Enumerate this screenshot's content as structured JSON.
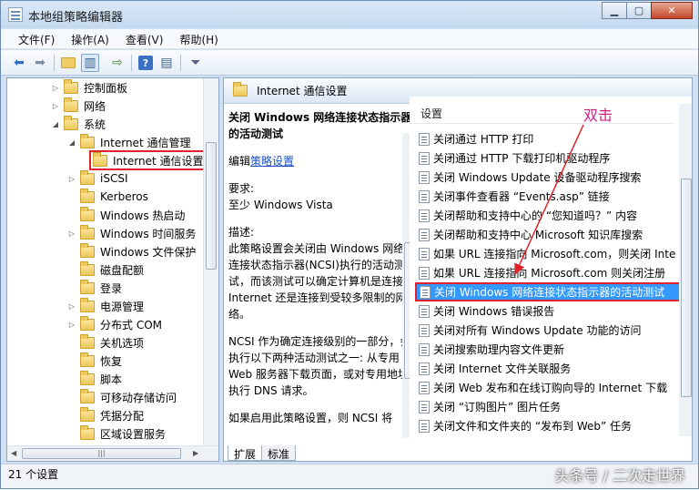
{
  "window": {
    "title": "本地组策略编辑器"
  },
  "menu": {
    "items": [
      "文件(F)",
      "操作(A)",
      "查看(V)",
      "帮助(H)"
    ]
  },
  "tree": {
    "items": [
      {
        "label": "控制面板",
        "arrow": "▷"
      },
      {
        "label": "网络",
        "arrow": "▷"
      },
      {
        "label": "系统",
        "arrow": "◢"
      },
      {
        "label": "Internet 通信管理",
        "arrow": "◢"
      },
      {
        "label": "Internet 通信设置",
        "arrow": ""
      },
      {
        "label": "iSCSI",
        "arrow": "▷"
      },
      {
        "label": "Kerberos",
        "arrow": ""
      },
      {
        "label": "Windows 热启动",
        "arrow": ""
      },
      {
        "label": "Windows 时间服务",
        "arrow": "▷"
      },
      {
        "label": "Windows 文件保护",
        "arrow": ""
      },
      {
        "label": "磁盘配额",
        "arrow": ""
      },
      {
        "label": "登录",
        "arrow": ""
      },
      {
        "label": "电源管理",
        "arrow": "▷"
      },
      {
        "label": "分布式 COM",
        "arrow": "▷"
      },
      {
        "label": "关机选项",
        "arrow": ""
      },
      {
        "label": "恢复",
        "arrow": ""
      },
      {
        "label": "脚本",
        "arrow": ""
      },
      {
        "label": "可移动存储访问",
        "arrow": ""
      },
      {
        "label": "凭据分配",
        "arrow": ""
      },
      {
        "label": "区域设置服务",
        "arrow": ""
      }
    ]
  },
  "right": {
    "header": "Internet 通信设置",
    "description": {
      "title": "关闭 Windows 网络连接状态指示器的活动测试",
      "edit_prefix": "编辑",
      "edit_link": "策略设置",
      "req_label": "要求:",
      "req_value": "至少 Windows Vista",
      "desc_label": "描述:",
      "desc_text": "此策略设置会关闭由 Windows 网络连接状态指示器(NCSI)执行的活动测试，而该测试可以确定计算机是连接到 Internet 还是连接到受较多限制的网络。",
      "desc_text2": "NCSI 作为确定连接级别的一部分，会执行以下两种活动测试之一: 从专用 Web 服务器下载页面，或对专用地址执行 DNS 请求。",
      "desc_text3": "如果启用此策略设置，则 NCSI 将"
    },
    "list": {
      "header": "设置",
      "items": [
        "关闭通过 HTTP 打印",
        "关闭通过 HTTP 下载打印机驱动程序",
        "关闭 Windows Update 设备驱动程序搜索",
        "关闭事件查看器 “Events.asp” 链接",
        "关闭帮助和支持中心的 “您知道吗？” 内容",
        "关闭帮助和支持中心 Microsoft 知识库搜索",
        "如果 URL 连接指向 Microsoft.com，则关闭 Inte",
        "如果 URL 连接指向 Microsoft.com 则关闭注册",
        "关闭 Windows 网络连接状态指示器的活动测试",
        "关闭 Windows 错误报告",
        "关闭对所有 Windows Update 功能的访问",
        "关闭搜索助理内容文件更新",
        "关闭 Internet 文件关联服务",
        "关闭 Web 发布和在线订购向导的 Internet 下载",
        "关闭 “订购图片” 图片任务",
        "关闭文件和文件夹的 “发布到 Web” 任务"
      ],
      "selected_index": 8
    },
    "tabs": [
      "扩展",
      "标准"
    ]
  },
  "status": {
    "text": "21 个设置"
  },
  "annotation": {
    "text": "双击",
    "color": "#d81b86"
  },
  "watermark": "头条号 / 二次走世界"
}
